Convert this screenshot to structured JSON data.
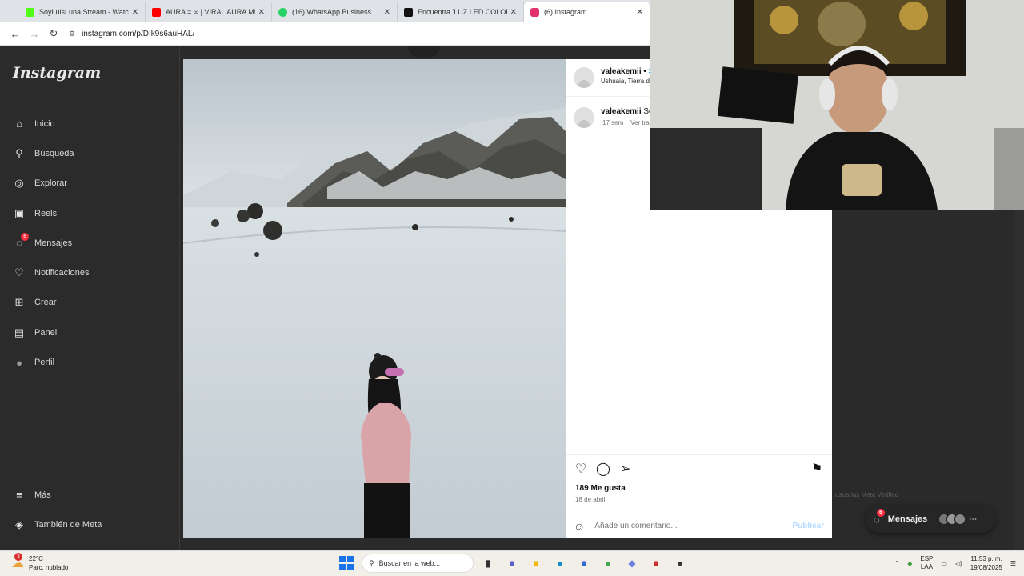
{
  "browser": {
    "tabs": [
      {
        "title": "SoyLuisLuna Stream - Watch Li",
        "color": "#53fc18"
      },
      {
        "title": "AURA = ∞ | VIRAL AURA MUS",
        "color": "#ff0000"
      },
      {
        "title": "(16) WhatsApp Business",
        "color": "#25d366"
      },
      {
        "title": "Encuentra 'LUZ LED COLOR AZ",
        "color": "#111111"
      },
      {
        "title": "(6) Instagram",
        "color": "#e1306c"
      }
    ],
    "url": "instagram.com/p/DIk9s6auHAL/"
  },
  "sidebar": {
    "logo": "Instagram",
    "items": [
      {
        "label": "Inicio",
        "icon": "home-icon",
        "glyph": "⌂"
      },
      {
        "label": "Búsqueda",
        "icon": "search-icon",
        "glyph": "⚲"
      },
      {
        "label": "Explorar",
        "icon": "compass-icon",
        "glyph": "◎"
      },
      {
        "label": "Reels",
        "icon": "reels-icon",
        "glyph": "▣"
      },
      {
        "label": "Mensajes",
        "icon": "messenger-icon",
        "glyph": "◌",
        "badge": "6"
      },
      {
        "label": "Notificaciones",
        "icon": "heart-icon",
        "glyph": "♡"
      },
      {
        "label": "Crear",
        "icon": "plus-icon",
        "glyph": "⊞"
      },
      {
        "label": "Panel",
        "icon": "chart-icon",
        "glyph": "▤"
      },
      {
        "label": "Perfil",
        "icon": "avatar-icon",
        "glyph": "●"
      }
    ],
    "bottom": [
      {
        "label": "Más",
        "icon": "menu-icon",
        "glyph": "≡"
      },
      {
        "label": "También de Meta",
        "icon": "meta-icon",
        "glyph": "◈"
      }
    ]
  },
  "post": {
    "username": "valeakemii",
    "follow": "S",
    "location": "Ushuaia, Tierra de",
    "caption_user": "valeakemii",
    "caption_text": "Sor",
    "caption_age": "17 sem",
    "caption_translate": "Ver trad",
    "likes": "189 Me gusta",
    "date": "18 de abril",
    "comment_placeholder": "Añade un comentario...",
    "publish": "Publicar"
  },
  "footer": {
    "links": "usuarias     Meta Verified"
  },
  "messages_pill": {
    "label": "Mensajes",
    "badge": "6"
  },
  "taskbar": {
    "weather_temp": "22°C",
    "weather_desc": "Parc. nublado",
    "weather_badge": "3",
    "search_placeholder": "Buscar en la web...",
    "lang_top": "ESP",
    "lang_bottom": "LAA",
    "time": "11:53 p. m.",
    "date": "19/08/2025"
  }
}
